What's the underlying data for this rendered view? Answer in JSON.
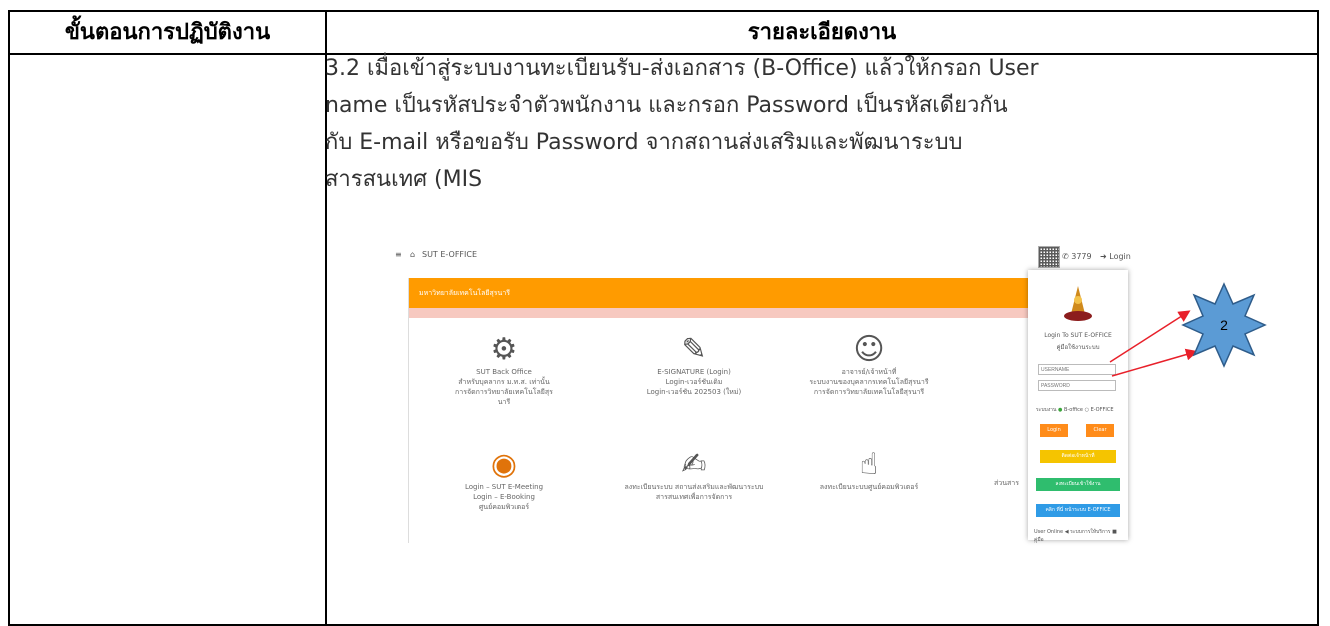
{
  "table": {
    "col1_header": "ขั้นตอนการปฏิบัติงาน",
    "col2_header": "รายละเอียดงาน"
  },
  "paragraph": {
    "lines": [
      "3.2 เมื่อเข้าสู่ระบบงานทะเบียนรับ-ส่งเอกสาร (B-Office) แล้วให้กรอก User",
      "name เป็นรหัสประจำตัวพนักงาน และกรอก Password เป็นรหัสเดียวกัน",
      "กับ E-mail หรือขอรับ Password จากสถานส่งเสริมและพัฒนาระบบ",
      "สารสนเทศ (MIS"
    ]
  },
  "screenshot": {
    "brand": "SUT E-OFFICE",
    "phone": "3779",
    "login_link": "Login",
    "orange_bar_text": "มหาวิทยาลัยเทคโนโลยีสุรนารี",
    "services": [
      {
        "icon": "gears-icon",
        "glyph": "⚙",
        "lines": [
          "SUT Back Office",
          "สำหรับบุคลากร ม.ท.ส. เท่านั้น",
          "การจัดการวิทยาลัยเทคโนโลยีสุรนารี"
        ]
      },
      {
        "icon": "signature-icon",
        "glyph": "✎",
        "lines": [
          "E-SIGNATURE (Login)",
          "Login-เวอร์ชันเดิม",
          "Login-เวอร์ชัน 202503 (ใหม่)"
        ]
      },
      {
        "icon": "person-icon",
        "glyph": "☺",
        "lines": [
          "อาจารย์/เจ้าหน้าที่",
          "ระบบงานของบุคลากรเทคโนโลยีสุรนารี",
          "การจัดการวิทยาลัยเทคโนโลยีสุรนารี"
        ]
      },
      {
        "icon": "meeting-icon",
        "glyph": "◉",
        "lines": [
          "Login – SUT E-Meeting",
          "Login – E-Booking",
          "ศูนย์คอมพิวเตอร์"
        ]
      },
      {
        "icon": "document-icon",
        "glyph": "✍",
        "lines": [
          "ลงทะเบียนระบบ สถานส่งเสริมและพัฒนาระบบ",
          "สารสนเทศเพื่อการจัดการ"
        ]
      },
      {
        "icon": "touch-icon",
        "glyph": "☝",
        "lines": [
          "ลงทะเบียนระบบศูนย์คอมพิวเตอร์"
        ]
      }
    ],
    "partial_service_text": "ส่วนสาร",
    "login_panel": {
      "title": "Login To SUT E-OFFICE",
      "subtitle": "คู่มือใช้งานระบบ",
      "username_placeholder": "USERNAME",
      "password_placeholder": "PASSWORD",
      "radio_label": "ระบบงาน",
      "radio_opt1": "B-office",
      "radio_opt2": "E-OFFICE",
      "login_btn": "Login",
      "clear_btn": "Clear",
      "yellow_btn": "ติดต่อเจ้าหน้าที่",
      "green_btn": "ลงทะเบียนเข้าใช้งาน",
      "blue_btn": "คลิก ที่นี่ หน้าระบบ E-OFFICE",
      "footer": "User Online  ◀ ระบบการให้บริการ  ■ คู่มือ"
    },
    "badge_label": "2"
  },
  "colors": {
    "orange": "#ff9b00",
    "badge_fill": "#5b9bd5",
    "badge_stroke": "#2e5c8a",
    "arrow": "#e8202a"
  }
}
